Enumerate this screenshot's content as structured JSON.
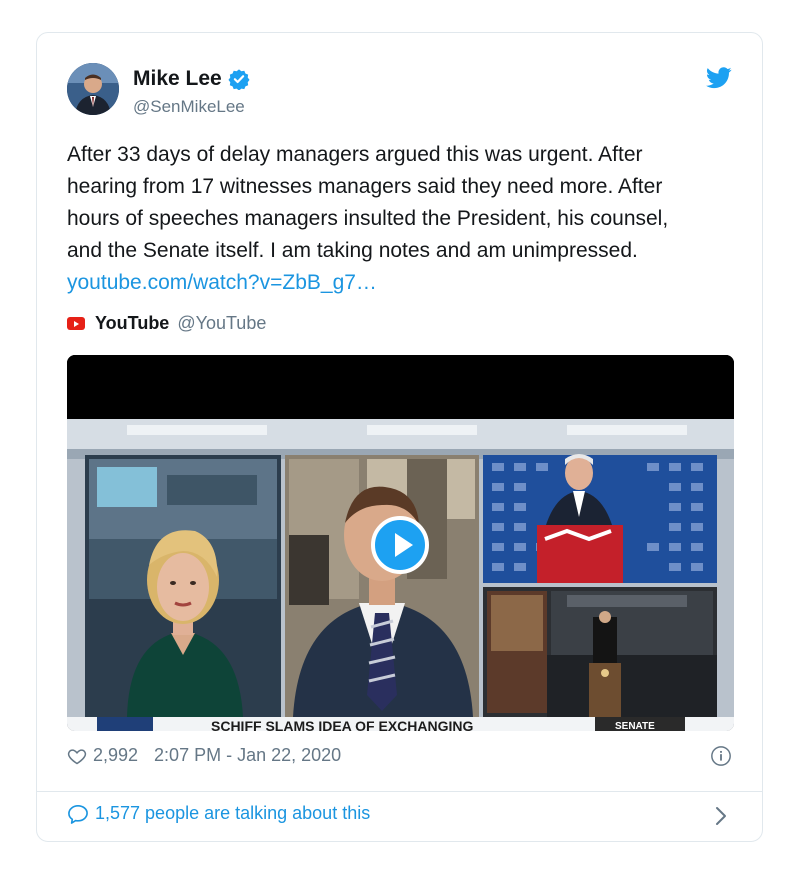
{
  "author": {
    "name": "Mike Lee",
    "handle": "@SenMikeLee"
  },
  "tweet": {
    "lines": [
      "After 33 days of delay managers argued this was urgent. After",
      "hearing from 17 witnesses managers said they need more. After",
      "hours of speeches managers insulted the President, his counsel,",
      "and the Senate itself. I am taking notes and am unimpressed."
    ],
    "link": "youtube.com/watch?v=ZbB_g7…"
  },
  "source": {
    "name": "YouTube",
    "handle": "@YouTube"
  },
  "video": {
    "chyron_text": "SCHIFF SLAMS IDEA OF EXCHANGING",
    "corner_label": "SENATE"
  },
  "meta": {
    "likes": "2,992",
    "timestamp": "2:07 PM - Jan 22, 2020"
  },
  "footer": {
    "talking": "1,577 people are talking about this"
  },
  "colors": {
    "link": "#1b95e0",
    "twitter_blue": "#1da1f2",
    "youtube_red": "#e62117",
    "muted": "#657786"
  }
}
